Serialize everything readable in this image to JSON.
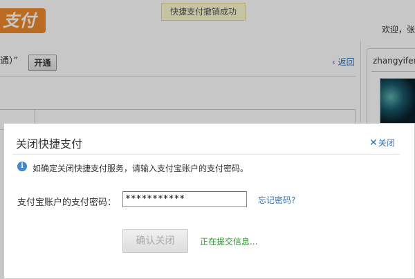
{
  "background": {
    "logo_text": "支付",
    "welcome": "欢迎，张",
    "toast": "快捷支付撤销成功",
    "panel_title": "通）”",
    "open_button": "开通",
    "back_link": "返回",
    "side_username": "zhangyifen"
  },
  "dialog": {
    "title": "关闭快捷支付",
    "close_label": "关闭",
    "info_text": "如确定关闭快捷支付服务，请输入支付宝账户的支付密码。",
    "password_label": "支付宝账户的支付密码：",
    "password_value": "***********",
    "forgot_link": "忘记密码?",
    "confirm_button": "确认关闭",
    "status_text": "正在提交信息..."
  },
  "colors": {
    "link": "#2b70c2",
    "status_green": "#2a9a2a",
    "logo_orange": "#f08a2a",
    "toast_bg": "#fcfbd0"
  }
}
